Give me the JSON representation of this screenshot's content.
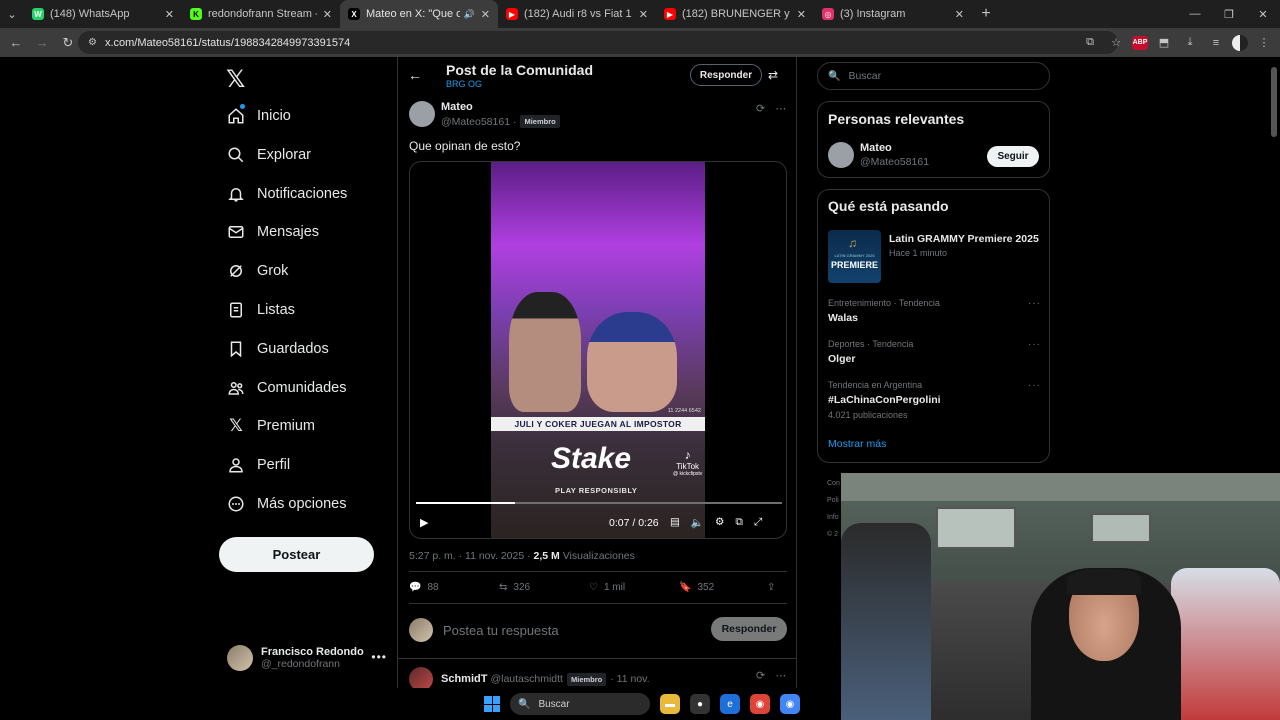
{
  "browser": {
    "tabs": [
      {
        "title": "(148) WhatsApp",
        "color": "#25d366",
        "glyph": "W"
      },
      {
        "title": "redondofrann Stream - Watch Liv",
        "color": "#53fc18",
        "glyph": "K"
      },
      {
        "title": "Mateo en X: \"Que opinan de esto?\"",
        "color": "#000000",
        "glyph": "X",
        "active": true
      },
      {
        "title": "(182) Audi r8 vs Fiat 1 copa de l",
        "color": "#ff0000",
        "glyph": "▶"
      },
      {
        "title": "(182) BRUNENGER y PABLO se e",
        "color": "#ff0000",
        "glyph": "▶"
      },
      {
        "title": "(3) Instagram",
        "color": "#e1306c",
        "glyph": "◎"
      }
    ],
    "url": "x.com/Mateo58161/status/1988342849973391574"
  },
  "nav": {
    "home": "Inicio",
    "explore": "Explorar",
    "notifications": "Notificaciones",
    "messages": "Mensajes",
    "grok": "Grok",
    "lists": "Listas",
    "bookmarks": "Guardados",
    "communities": "Comunidades",
    "premium": "Premium",
    "profile": "Perfil",
    "more": "Más opciones",
    "post_button": "Postear"
  },
  "account": {
    "name": "Francisco Redondo",
    "handle": "@_redondofrann"
  },
  "header": {
    "title": "Post de la Comunidad",
    "community": "BRG OG",
    "reply_label": "Responder"
  },
  "post": {
    "author": "Mateo",
    "handle": "@Mateo58161 ·",
    "badge": "Miembro",
    "text": "Que opinan de esto?",
    "video": {
      "caption": "JULI Y COKER JUEGAN AL IMPOSTOR",
      "code": "11 2244 6542",
      "brand": "Stake",
      "brand_sub": "PLAY RESPONSIBLY",
      "watermark": "TikTok",
      "watermark_handle": "@ kickcfipstv",
      "time": "0:07 / 0:26",
      "progress": 0.27
    },
    "timestamp": "5:27 p. m. · 11 nov. 2025 ·",
    "views": "2,5 M",
    "views_label": "Visualizaciones",
    "stats": {
      "replies": "88",
      "reposts": "326",
      "likes": "1 mil",
      "bookmarks": "352"
    }
  },
  "reply_composer": {
    "placeholder": "Postea tu respuesta",
    "button": "Responder"
  },
  "next_reply": {
    "name": "SchmidT",
    "handle": "@lautaschmidtt",
    "badge": "Miembro",
    "date": "· 11 nov."
  },
  "sidebar": {
    "search_placeholder": "Buscar",
    "relevant_title": "Personas relevantes",
    "relevant_person": {
      "name": "Mateo",
      "handle": "@Mateo58161",
      "follow": "Seguir"
    },
    "trending_title": "Qué está pasando",
    "featured": {
      "title": "Latin GRAMMY Premiere 2025",
      "time": "Hace 1 minuto",
      "thumb_label": "PREMIERE",
      "thumb_sub": "LATIN GRAMMY 2025"
    },
    "trends": [
      {
        "category": "Entretenimiento · Tendencia",
        "name": "Walas",
        "count": ""
      },
      {
        "category": "Deportes · Tendencia",
        "name": "Olger",
        "count": ""
      },
      {
        "category": "Tendencia en Argentina",
        "name": "#LaChinaConPergolini",
        "count": "4.021 publicaciones"
      }
    ],
    "show_more": "Mostrar más",
    "footer": [
      "Con",
      "Poli",
      "Info",
      "© 2"
    ]
  },
  "taskbar": {
    "search": "Buscar"
  }
}
